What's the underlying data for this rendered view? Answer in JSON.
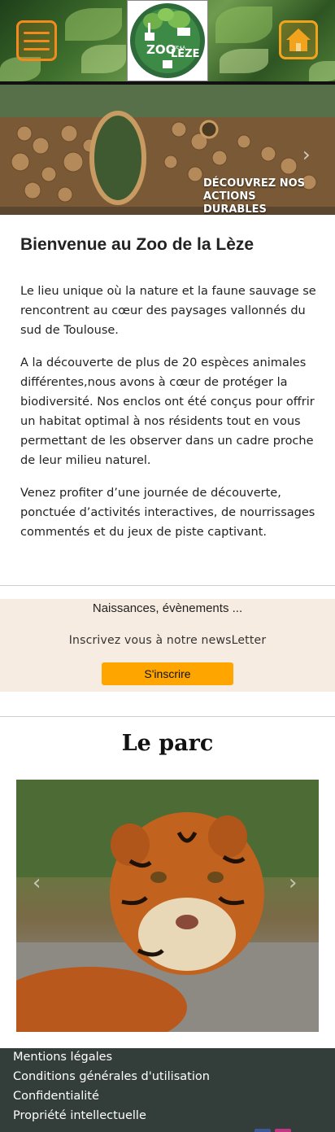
{
  "header": {
    "logo": {
      "line1": "ZOO",
      "line2": "DE LA",
      "line3": "LÈZE"
    }
  },
  "hero": {
    "caption_line1": "DÉCOUVREZ NOS",
    "caption_line2": "ACTIONS DURABLES",
    "next_arrow": "›"
  },
  "welcome": {
    "title": "Bienvenue au Zoo de la Lèze",
    "paragraphs": [
      "Le lieu unique où la nature et la faune sauvage se rencontrent au cœur des paysages vallonnés du sud de Toulouse.",
      "A la découverte de plus de 20 espèces animales différentes,nous avons à cœur de protéger la biodiversité. Nos enclos ont été conçus pour offrir un habitat optimal à nos résidents tout en vous permettant de les observer dans un cadre proche de leur milieu naturel.",
      "Venez profiter d’une journée de découverte, ponctuée d’activités interactives, de nourrissages commentés et du jeux de piste captivant."
    ]
  },
  "newsletter": {
    "line1": "Naissances, évènements ...",
    "line2": "Inscrivez vous à notre newsLetter",
    "button": "S'inscrire"
  },
  "parc": {
    "title": "Le parc",
    "prev_arrow": "‹",
    "next_arrow": "›"
  },
  "footer": {
    "links": [
      "Mentions légales",
      "Conditions générales d'utilisation",
      "Confidentialité",
      "Propriété intellectuelle"
    ]
  },
  "colors": {
    "menu_accent": "#f28a1e",
    "home_accent": "#f2a31e",
    "button": "#ffa500",
    "newsletter_bg": "#f7ece1",
    "footer_bg": "#333d3a"
  },
  "icons": [
    "menu-icon",
    "home-icon",
    "chevron-left-icon",
    "chevron-right-icon"
  ]
}
